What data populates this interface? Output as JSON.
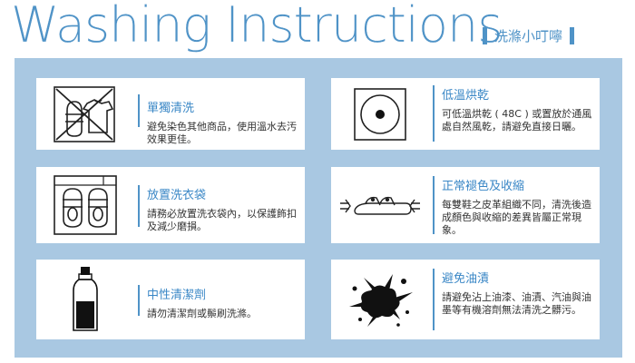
{
  "header": {
    "title": "Washing Instructions",
    "subtitle": "洗滌小叮嚀"
  },
  "cards": [
    {
      "title": "單獨清洗",
      "desc": "避免染色其他商品，使用溫水去汚效果更佳。",
      "icon": "no-mixing-shoes-icon"
    },
    {
      "title": "低溫烘乾",
      "desc": "可低溫烘乾 ( 48C ) 或置放於通風處自然風乾，請避免直接日曬。",
      "icon": "low-heat-dry-icon"
    },
    {
      "title": "放置洗衣袋",
      "desc": "請務必放置洗衣袋內，以保護飾扣及減少磨損。",
      "icon": "laundry-bag-icon"
    },
    {
      "title": "正常褪色及收縮",
      "desc": "每雙鞋之皮革組織不同，清洗後造成顏色與收縮的差異皆屬正常現象。",
      "icon": "shrink-sandal-icon"
    },
    {
      "title": "中性清潔劑",
      "desc": "請勿清潔劑或鬃刷洗滌。",
      "icon": "detergent-bottle-icon"
    },
    {
      "title": "避免油漬",
      "desc": "請避免沾上油漆、油漬、汽油與油墨等有機溶劑無法清洗之髒污。",
      "icon": "oil-stain-icon"
    }
  ]
}
